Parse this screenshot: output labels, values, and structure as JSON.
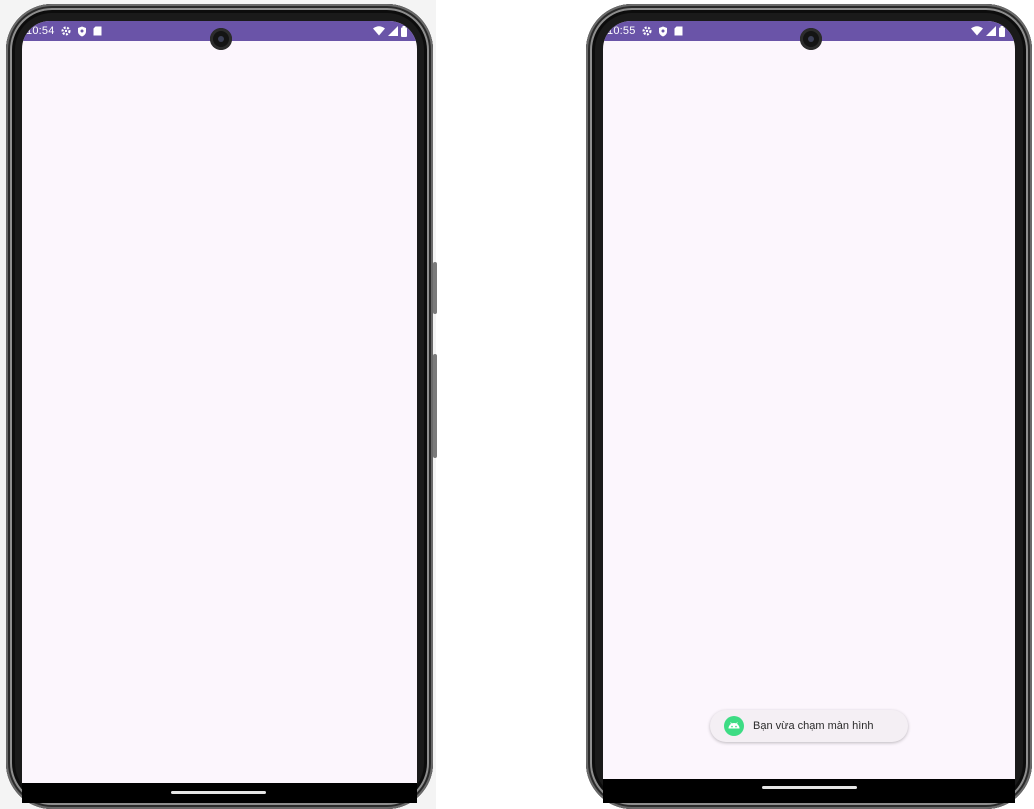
{
  "screens": [
    {
      "status_bar": {
        "time": "10:54",
        "icons_left": [
          "gear-icon",
          "shield-icon",
          "sd-card-icon"
        ],
        "icons_right": [
          "wifi-icon",
          "signal-icon",
          "battery-icon"
        ]
      }
    },
    {
      "status_bar": {
        "time": "10:55",
        "icons_left": [
          "gear-icon",
          "shield-icon",
          "sd-card-icon"
        ],
        "icons_right": [
          "wifi-icon",
          "signal-icon",
          "battery-icon"
        ]
      },
      "toast": {
        "icon": "android-icon",
        "message": "Bạn vừa chạm màn hình"
      }
    }
  ],
  "colors": {
    "status_bar": "#6a54a8",
    "screen_background": "#fcf6fd",
    "toast_background": "#f4eff4",
    "android_green": "#3ddc84"
  }
}
